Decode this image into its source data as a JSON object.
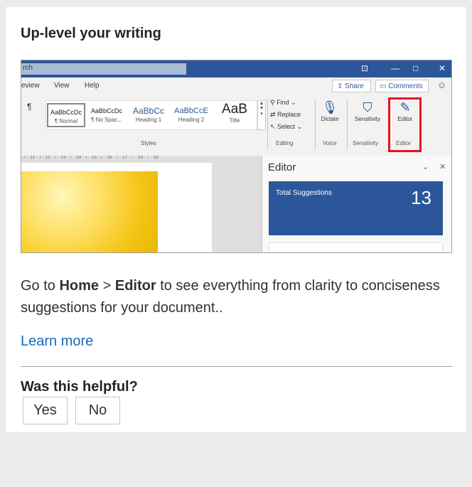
{
  "card": {
    "title": "Up-level your writing",
    "description": {
      "prefix": "Go to ",
      "home": "Home",
      "separator": " > ",
      "editor": "Editor",
      "suffix": " to see everything from clarity to conciseness suggestions for your document.."
    },
    "learn_more": "Learn more",
    "feedback": {
      "question": "Was this helpful?",
      "yes": "Yes",
      "no": "No"
    }
  },
  "screenshot": {
    "search_text": "rch",
    "menu": [
      "eview",
      "View",
      "Help"
    ],
    "share": "Share",
    "comments": "Comments",
    "styles": [
      {
        "sample": "AaBbCcDc",
        "name": "¶ Normal"
      },
      {
        "sample": "AaBbCcDc",
        "name": "¶ No Spac..."
      },
      {
        "sample": "AaBbCc",
        "name": "Heading 1"
      },
      {
        "sample": "AaBbCcE",
        "name": "Heading 2"
      },
      {
        "sample": "AaB",
        "name": "Title"
      }
    ],
    "styles_label": "Styles",
    "editing": {
      "find": "Find",
      "replace": "Replace",
      "select": "Select",
      "label": "Editing"
    },
    "dictate": {
      "button": "Dictate",
      "label": "Voice"
    },
    "sensitivity": {
      "button": "Sensitivity",
      "label": "Sensitivity"
    },
    "editor": {
      "button": "Editor",
      "label": "Editor"
    },
    "ruler": "· ı · 11 · ı · 12 · ı · 13 · ı · 14 · ı · 15 · ı · 16 · ı · 17 · ı · 18 · ı · 19",
    "pane": {
      "title": "Editor",
      "total_label": "Total Suggestions",
      "total_count": "13"
    },
    "colors": {
      "word_blue": "#2b579a",
      "highlight_red": "#e81123"
    }
  }
}
